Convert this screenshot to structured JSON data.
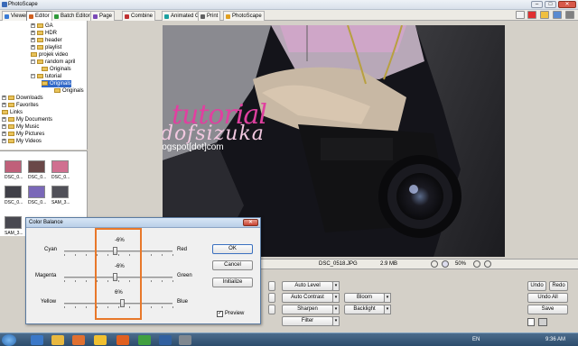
{
  "window": {
    "title": "PhotoScape",
    "min": "–",
    "max": "□",
    "close": "✕"
  },
  "tabs": [
    {
      "label": "Viewer",
      "color": "#3a7bd5"
    },
    {
      "label": "Editor",
      "color": "#d06020"
    },
    {
      "label": "Batch Editor",
      "color": "#2e9a3a"
    },
    {
      "label": "Page",
      "color": "#7a4ab8"
    },
    {
      "label": "Combine",
      "color": "#c03030"
    },
    {
      "label": "Animated GIF",
      "color": "#1aa0a0"
    },
    {
      "label": "Print",
      "color": "#606060"
    },
    {
      "label": "PhotoScape",
      "color": "#e0a020"
    }
  ],
  "tree": [
    {
      "label": "GA",
      "indent": 2,
      "exp": "+"
    },
    {
      "label": "HDR",
      "indent": 2,
      "exp": "+"
    },
    {
      "label": "header",
      "indent": 2,
      "exp": "+"
    },
    {
      "label": "playlist",
      "indent": 2,
      "exp": "+"
    },
    {
      "label": "projek video",
      "indent": 2,
      "exp": ""
    },
    {
      "label": "random april",
      "indent": 2,
      "exp": "−"
    },
    {
      "label": "Originals",
      "indent": 3,
      "exp": ""
    },
    {
      "label": "tutorial",
      "indent": 2,
      "exp": "−"
    },
    {
      "label": "Originals",
      "indent": 3,
      "exp": "",
      "selected": true
    },
    {
      "label": "Originals",
      "indent": 4,
      "exp": ""
    },
    {
      "label": "Downloads",
      "indent": 0,
      "exp": "+"
    },
    {
      "label": "Favorites",
      "indent": 0,
      "exp": "+"
    },
    {
      "label": "Links",
      "indent": 0,
      "exp": ""
    },
    {
      "label": "My Documents",
      "indent": 0,
      "exp": "+"
    },
    {
      "label": "My Music",
      "indent": 0,
      "exp": "+"
    },
    {
      "label": "My Pictures",
      "indent": 0,
      "exp": "+"
    },
    {
      "label": "My Videos",
      "indent": 0,
      "exp": "+"
    }
  ],
  "thumbnails": [
    {
      "label": "DSC_0...",
      "color": "#c0607a"
    },
    {
      "label": "DSC_0...",
      "color": "#6a4848"
    },
    {
      "label": "DSC_0...",
      "color": "#d07090"
    },
    {
      "label": "DSC_0...",
      "color": "#404048"
    },
    {
      "label": "DSC_0...",
      "color": "#7a68b8"
    },
    {
      "label": "SAM_3...",
      "color": "#505058"
    },
    {
      "label": "SAM_3...",
      "color": "#484850"
    }
  ],
  "photo": {
    "overlay_title": "tutorial",
    "overlay_name": "Worldofsizuka",
    "overlay_sub": "[dot]blogspot[dot]com"
  },
  "status": {
    "filename": "DSC_0518.JPG",
    "filesize": "2.9 MB",
    "zoom": "50%"
  },
  "tools": {
    "auto_level": "Auto Level",
    "auto_contrast": "Auto Contrast",
    "sharpen": "Sharpen",
    "filter": "Filter",
    "bloom": "Bloom",
    "backlight": "Backlight",
    "undo": "Undo",
    "redo": "Redo",
    "undo_all": "Undo All",
    "save": "Save"
  },
  "dialog": {
    "title": "Color Balance",
    "close": "✕",
    "ok": "OK",
    "cancel": "Cancel",
    "initialize": "Initialize",
    "preview": "Preview",
    "preview_checked": true,
    "sliders": [
      {
        "left": "Cyan",
        "right": "Red",
        "value": "-6%",
        "level": -6
      },
      {
        "left": "Magenta",
        "right": "Green",
        "value": "-6%",
        "level": -6
      },
      {
        "left": "Yellow",
        "right": "Blue",
        "value": "6%",
        "level": 6
      }
    ]
  },
  "taskbar": {
    "lang": "EN",
    "time": "9:36 AM"
  },
  "accent_color": "#e8782a"
}
